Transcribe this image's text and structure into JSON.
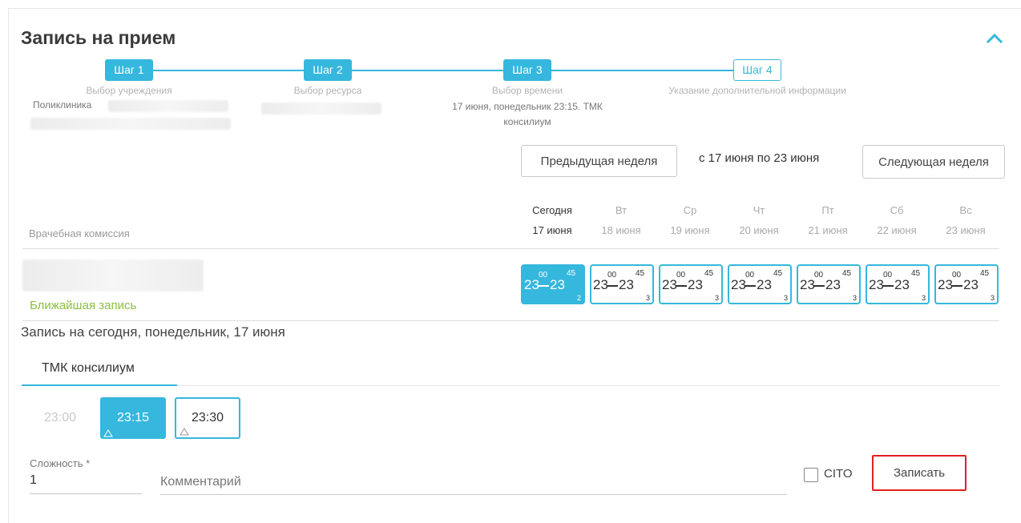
{
  "title": "Запись на прием",
  "steps": [
    {
      "label": "Шаг 1",
      "caption": "Выбор учреждения",
      "detail": "Поликлиника"
    },
    {
      "label": "Шаг 2",
      "caption": "Выбор ресурса"
    },
    {
      "label": "Шаг 3",
      "caption": "Выбор времени",
      "detail": "17 июня, понедельник 23:15. ТМК консилиум"
    },
    {
      "label": "Шаг 4",
      "caption": "Указание дополнительной информации"
    }
  ],
  "week_nav": {
    "prev_label": "Предыдущая неделя",
    "range": "с 17 июня по 23 июня",
    "next_label": "Следующая неделя"
  },
  "resource_column_label": "Врачебная комиссия",
  "days": [
    {
      "day": "Сегодня",
      "date": "17 июня"
    },
    {
      "day": "Вт",
      "date": "18 июня"
    },
    {
      "day": "Ср",
      "date": "19 июня"
    },
    {
      "day": "Чт",
      "date": "20 июня"
    },
    {
      "day": "Пт",
      "date": "21 июня"
    },
    {
      "day": "Сб",
      "date": "22 июня"
    },
    {
      "day": "Вс",
      "date": "23 июня"
    }
  ],
  "slots": [
    {
      "from_h": "23",
      "from_m": "00",
      "to_h": "23",
      "to_m": "45",
      "count": "2"
    },
    {
      "from_h": "23",
      "from_m": "00",
      "to_h": "23",
      "to_m": "45",
      "count": "3"
    },
    {
      "from_h": "23",
      "from_m": "00",
      "to_h": "23",
      "to_m": "45",
      "count": "3"
    },
    {
      "from_h": "23",
      "from_m": "00",
      "to_h": "23",
      "to_m": "45",
      "count": "3"
    },
    {
      "from_h": "23",
      "from_m": "00",
      "to_h": "23",
      "to_m": "45",
      "count": "3"
    },
    {
      "from_h": "23",
      "from_m": "00",
      "to_h": "23",
      "to_m": "45",
      "count": "3"
    },
    {
      "from_h": "23",
      "from_m": "00",
      "to_h": "23",
      "to_m": "45",
      "count": "3"
    }
  ],
  "nearest_label": "Ближайшая запись",
  "today_line": "Запись на сегодня, понедельник, 17 июня",
  "tab_label": "ТМК консилиум",
  "times": [
    "23:00",
    "23:15",
    "23:30"
  ],
  "complexity": {
    "label": "Сложность *",
    "value": "1"
  },
  "comment_placeholder": "Комментарий",
  "cito_label": "CITO",
  "submit_label": "Записать",
  "colors": {
    "accent": "#36b7dd",
    "nearest": "#8ac03f",
    "highlight": "#e02020"
  }
}
